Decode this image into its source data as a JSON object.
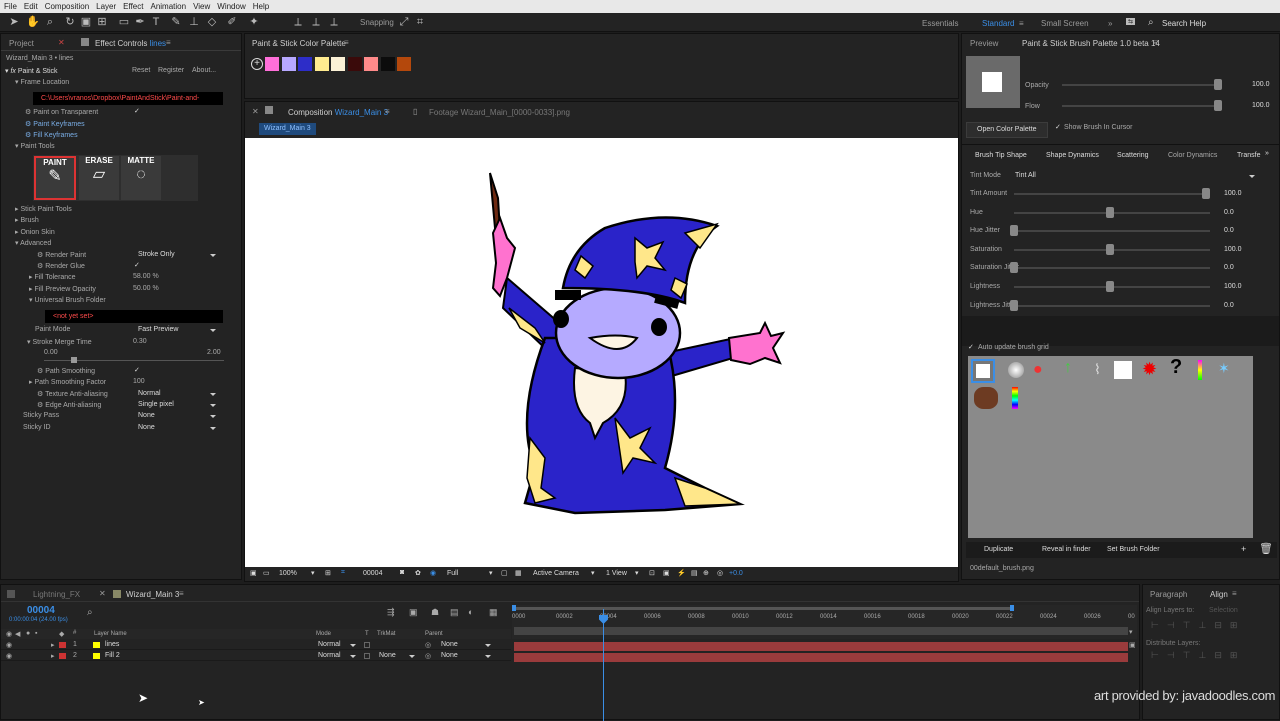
{
  "menu": [
    "File",
    "Edit",
    "Composition",
    "Layer",
    "Effect",
    "Animation",
    "View",
    "Window",
    "Help"
  ],
  "toolbar": {
    "snapping": "Snapping",
    "workspaces": [
      "Essentials",
      "Standard",
      "Small Screen"
    ],
    "search": "Search Help"
  },
  "project_tabs": {
    "project": "Project",
    "effect_controls": "Effect Controls",
    "layer": "lines"
  },
  "fx": {
    "title": "Wizard_Main 3 • lines",
    "name": "Paint & Stick",
    "reset": "Reset",
    "register": "Register",
    "about": "About...",
    "frame_location": "Frame Location",
    "path": "C:\\Users\\vranos\\Dropbox\\PaintAndStick\\Paint-and-",
    "paint_on_transparent": "Paint on Transparent",
    "paint_keyframes": "Paint Keyframes",
    "fill_keyframes": "Fill Keyframes",
    "paint_tools": "Paint Tools",
    "tool_paint": "PAINT",
    "tool_erase": "ERASE",
    "tool_matte": "MATTE",
    "stick_paint_tools": "Stick Paint Tools",
    "brush": "Brush",
    "onion_skin": "Onion Skin",
    "advanced": "Advanced",
    "render_paint": "Render Paint",
    "render_paint_val": "Stroke Only",
    "render_glue": "Render Glue",
    "fill_tolerance": "Fill Tolerance",
    "fill_tolerance_val": "58.00 %",
    "fill_preview_opacity": "Fill Preview Opacity",
    "fill_preview_opacity_val": "50.00 %",
    "universal_brush_folder": "Universal Brush Folder",
    "not_yet_set": "<not yet set>",
    "paint_mode": "Paint Mode",
    "paint_mode_val": "Fast Preview",
    "stroke_merge_time": "Stroke Merge Time",
    "stroke_merge_val": "0.30",
    "range_min": "0.00",
    "range_max": "2.00",
    "path_smoothing": "Path Smoothing",
    "path_smoothing_factor": "Path Smoothing Factor",
    "path_smoothing_factor_val": "100",
    "texture_aa": "Texture Anti-aliasing",
    "texture_aa_val": "Normal",
    "edge_aa": "Edge Anti-aliasing",
    "edge_aa_val": "Single pixel",
    "sticky_pass": "Sticky Pass",
    "sticky_pass_val": "None",
    "sticky_id": "Sticky ID",
    "sticky_id_val": "None",
    "check": "✓"
  },
  "palette": {
    "title": "Paint & Stick Color Palette",
    "colors": [
      "#ff6fd9",
      "#b7a8ff",
      "#2d2dc8",
      "#ffeb8f",
      "#fbf1d6",
      "#3a0a0a",
      "#ff8a8a",
      "#0c0c0c",
      "#b4480c"
    ]
  },
  "comp": {
    "tab": "Composition",
    "comp_name": "Wizard_Main 3",
    "footage": "Footage Wizard_Main_[0000-0033].png",
    "chip": "Wizard_Main 3",
    "zoom": "100%",
    "frame": "00004",
    "resolution": "Full",
    "camera": "Active Camera",
    "view": "1 View",
    "exposure": "+0.0"
  },
  "brush": {
    "preview_tab": "Preview",
    "title": "Paint & Stick Brush Palette 1.0 beta 14",
    "opacity": "Opacity",
    "opacity_val": "100.0",
    "opacity_level": 100,
    "flow": "Flow",
    "flow_val": "100.0",
    "flow_level": 100,
    "open_palette": "Open Color Palette",
    "show_brush": "Show Brush In Cursor",
    "tabs": [
      "Brush Tip Shape",
      "Shape Dynamics",
      "Scattering",
      "Color Dynamics",
      "Transfe"
    ],
    "tint_mode": "Tint Mode",
    "tint_mode_val": "Tint All",
    "dynamics": [
      {
        "label": "Tint Amount",
        "val": "100.0",
        "level": 100
      },
      {
        "label": "Hue",
        "val": "0.0",
        "level": 50
      },
      {
        "label": "Hue Jitter",
        "val": "0.0",
        "level": 0
      },
      {
        "label": "Saturation",
        "val": "100.0",
        "level": 50
      },
      {
        "label": "Saturation Jitter",
        "val": "0.0",
        "level": 0
      },
      {
        "label": "Lightness",
        "val": "100.0",
        "level": 50
      },
      {
        "label": "Lightness Jitter",
        "val": "0.0",
        "level": 0
      }
    ],
    "auto_update": "Auto update brush grid",
    "duplicate": "Duplicate",
    "reveal": "Reveal in finder",
    "set_folder": "Set Brush Folder",
    "plus": "+",
    "filename": "00default_brush.png"
  },
  "timeline": {
    "tab1": "Lightning_FX",
    "tab2": "Wizard_Main 3",
    "time": "00004",
    "fps": "0:00:00:04 (24.00 fps)",
    "col_layer": "Layer Name",
    "col_mode": "Mode",
    "col_t": "T",
    "col_trkmat": "TrkMat",
    "col_parent": "Parent",
    "layers": [
      {
        "num": "1",
        "name": "lines",
        "mode": "Normal",
        "trk": "",
        "parent": "None"
      },
      {
        "num": "2",
        "name": "Fill 2",
        "mode": "Normal",
        "trk": "None",
        "parent": "None"
      }
    ],
    "ruler": [
      "0000",
      "00002",
      "00004",
      "00006",
      "00008",
      "00010",
      "00012",
      "00014",
      "00016",
      "00018",
      "00020",
      "00022",
      "00024",
      "00026",
      "00"
    ]
  },
  "align": {
    "paragraph": "Paragraph",
    "align": "Align",
    "align_to": "Align Layers to:",
    "selection": "Selection",
    "distribute": "Distribute Layers:"
  },
  "credit": "art provided by: javadoodles.com"
}
